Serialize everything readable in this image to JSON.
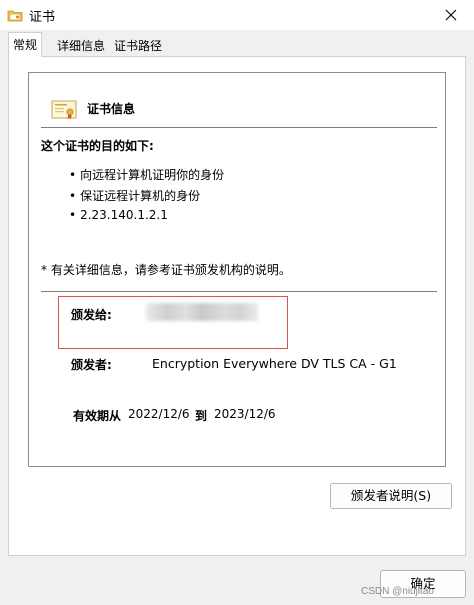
{
  "window": {
    "title": "证书",
    "icons": {
      "app": "certificate-folder-icon",
      "close": "close-icon"
    }
  },
  "tabs": [
    {
      "label": "常规",
      "active": true
    },
    {
      "label": "详细信息",
      "active": false
    },
    {
      "label": "证书路径",
      "active": false
    }
  ],
  "general": {
    "header_icon": "certificate-icon",
    "info_title": "证书信息",
    "purpose_title": "这个证书的目的如下:",
    "purposes": [
      "向远程计算机证明你的身份",
      "保证远程计算机的身份",
      "2.23.140.1.2.1"
    ],
    "bullet": "•",
    "note": "* 有关详细信息，请参考证书颁发机构的说明。",
    "issued_to_label": "颁发给:",
    "issued_to_value_redacted": true,
    "issued_by_label": "颁发者:",
    "issued_by_value": "Encryption Everywhere DV TLS CA - G1",
    "valid_label": "有效期从",
    "valid_from": "2022/12/6",
    "valid_to_label": "到",
    "valid_to": "2023/12/6",
    "highlight_color": "#d9534f"
  },
  "buttons": {
    "issuer_statement": "颁发者说明(S)",
    "ok": "确定"
  },
  "watermark": "CSDN @niujitao"
}
